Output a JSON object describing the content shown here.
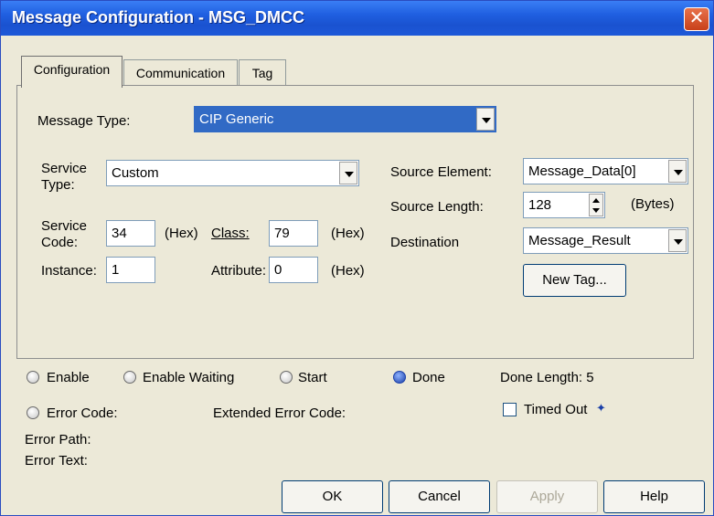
{
  "window": {
    "title": "Message Configuration - MSG_DMCC",
    "close_glyph": "✕"
  },
  "tabs": [
    {
      "label": "Configuration",
      "active": true
    },
    {
      "label": "Communication",
      "active": false
    },
    {
      "label": "Tag",
      "active": false
    }
  ],
  "config": {
    "message_type_label": "Message Type:",
    "message_type_value": "CIP Generic",
    "service_type_label_line1": "Service",
    "service_type_label_line2": "Type:",
    "service_type_value": "Custom",
    "service_code_label_line1": "Service",
    "service_code_label_line2": "Code:",
    "service_code_value": "34",
    "hex_label": "(Hex)",
    "class_label": "Class:",
    "class_value": "79",
    "instance_label": "Instance:",
    "instance_value": "1",
    "attribute_label": "Attribute:",
    "attribute_value": "0",
    "source_element_label": "Source Element:",
    "source_element_value": "Message_Data[0]",
    "source_length_label": "Source Length:",
    "source_length_value": "128",
    "bytes_label": "(Bytes)",
    "destination_label": "Destination",
    "destination_value": "Message_Result",
    "new_tag_button": "New Tag..."
  },
  "status": {
    "enable": "Enable",
    "enable_waiting": "Enable Waiting",
    "start": "Start",
    "done": "Done",
    "done_length": "Done Length: 5",
    "error_code": "Error Code:",
    "extended_error_code": "Extended Error Code:",
    "timed_out": "Timed Out",
    "timed_out_arrow": "✦",
    "error_path": "Error Path:",
    "error_text": "Error Text:"
  },
  "buttons": {
    "ok": "OK",
    "cancel": "Cancel",
    "apply": "Apply",
    "help": "Help"
  }
}
